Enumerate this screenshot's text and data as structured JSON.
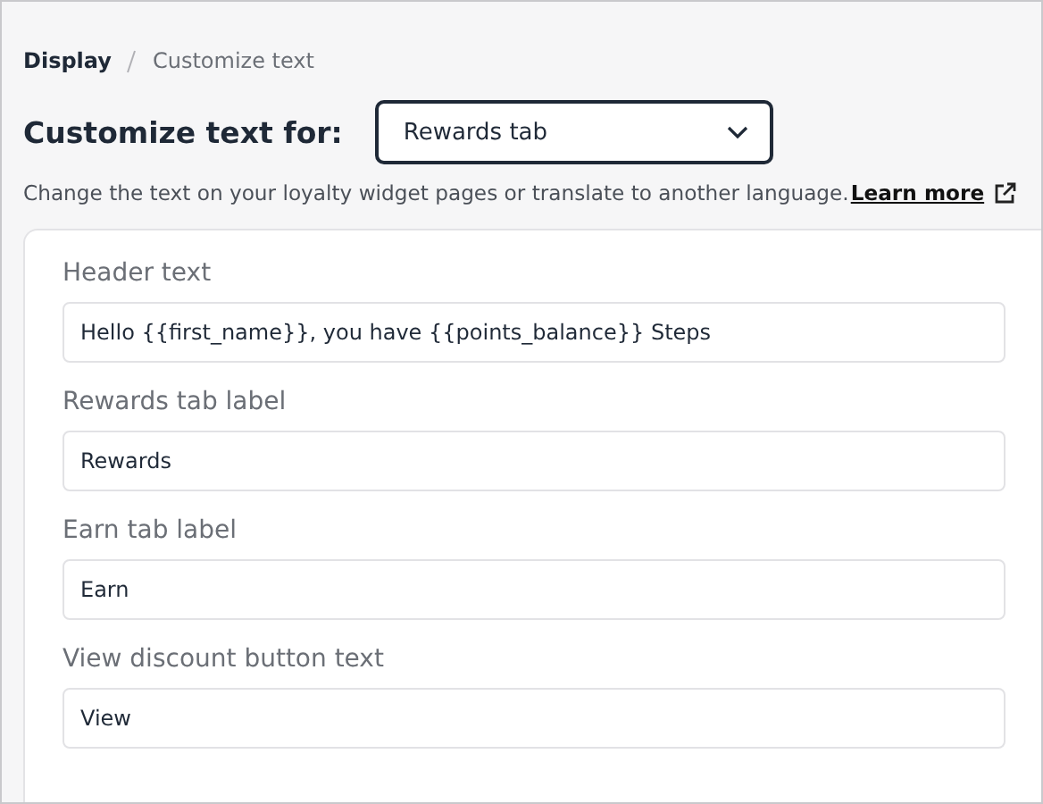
{
  "breadcrumb": [
    {
      "label": "Display",
      "current": false
    },
    {
      "label": "Customize text",
      "current": true
    }
  ],
  "customize": {
    "label": "Customize text for:",
    "value": "Rewards tab"
  },
  "description": {
    "text": "Change the text on your loyalty widget pages or translate to another language.",
    "link": "Learn more"
  },
  "fields": [
    {
      "label": "Header text",
      "value": "Hello {{first_name}}, you have {{points_balance}} Steps"
    },
    {
      "label": "Rewards tab label",
      "value": "Rewards"
    },
    {
      "label": "Earn tab label",
      "value": "Earn"
    },
    {
      "label": "View discount button text",
      "value": "View"
    }
  ]
}
